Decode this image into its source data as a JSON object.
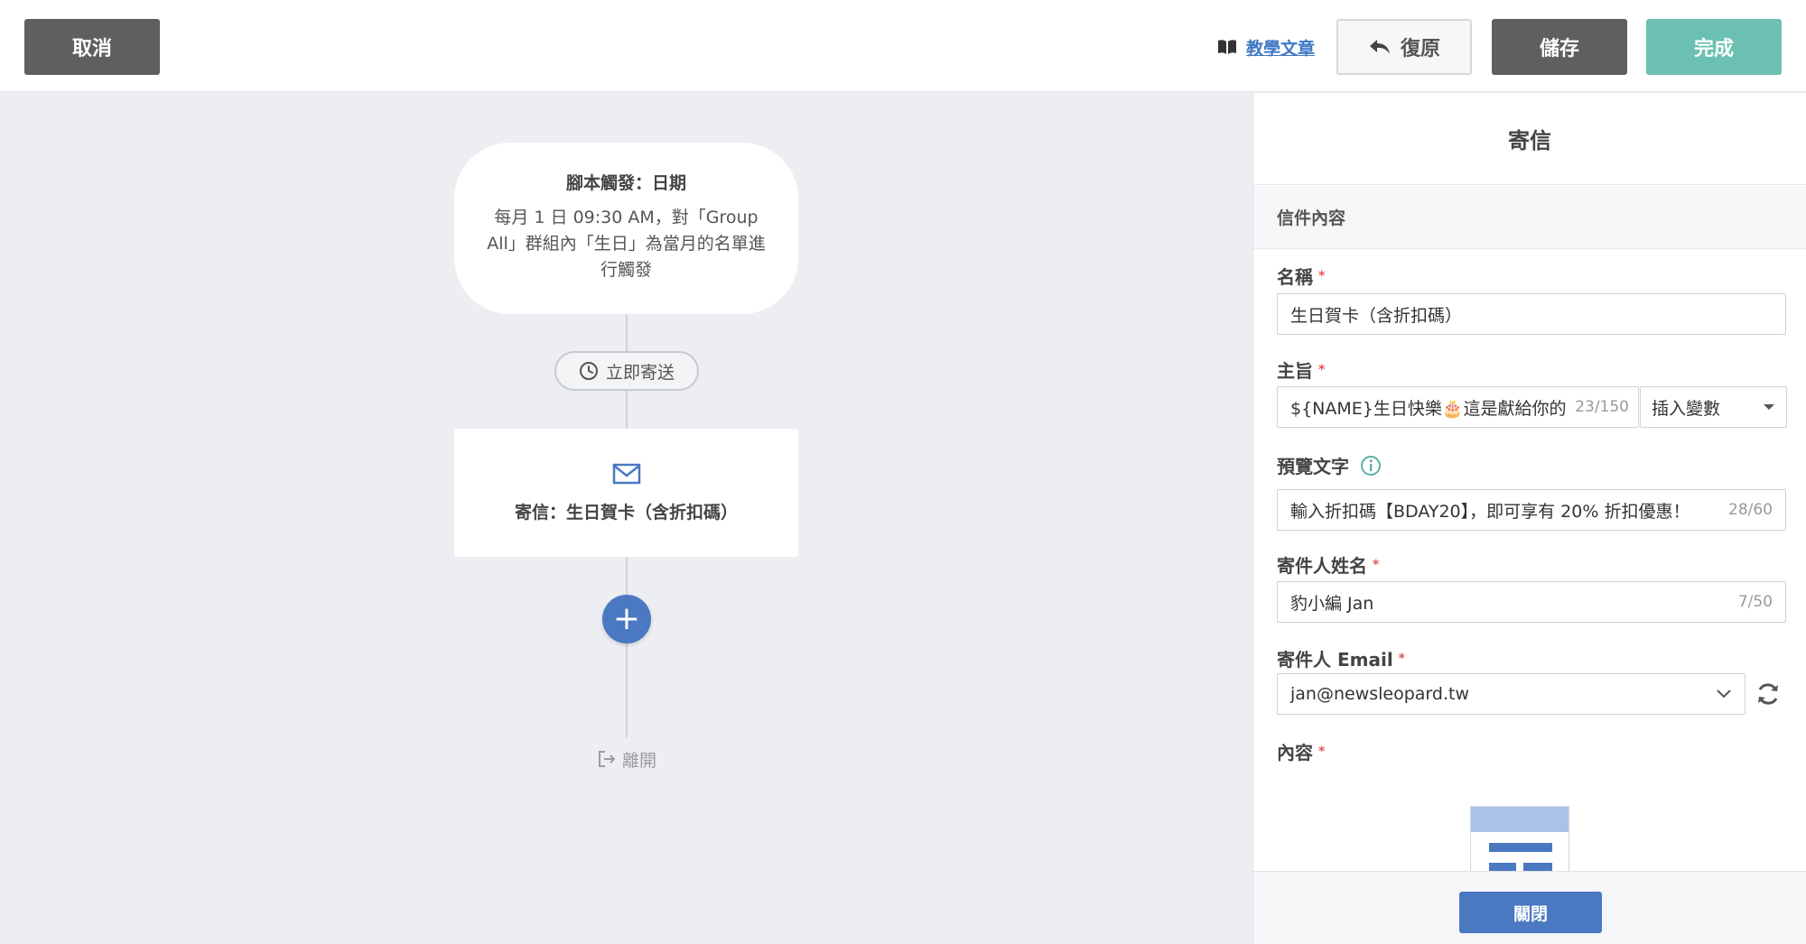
{
  "toolbar": {
    "cancel_label": "取消",
    "tutorial_label": "教學文章",
    "undo_label": "復原",
    "save_label": "儲存",
    "done_label": "完成"
  },
  "flow": {
    "trigger_title": "腳本觸發：日期",
    "trigger_desc": "每月 1 日 09:30 AM，對「Group All」群組內「生日」為當月的名單進行觸發",
    "delay_label": "立即寄送",
    "email_node_label": "寄信：生日賀卡（含折扣碼）",
    "add_label": "+",
    "exit_label": "離開"
  },
  "panel": {
    "title": "寄信",
    "section_title": "信件內容",
    "name_label": "名稱",
    "name_value": "生日賀卡（含折扣碼）",
    "subject_label": "主旨",
    "subject_value": "${NAME}生日快樂🎂這是獻給你的",
    "subject_count": "23/150",
    "insert_var_label": "插入變數",
    "preview_label": "預覽文字",
    "preview_value": "輸入折扣碼【BDAY20】，即可享有 20% 折扣優惠！",
    "preview_count": "28/60",
    "sender_name_label": "寄件人姓名",
    "sender_name_value": "豹小編 Jan",
    "sender_name_count": "7/50",
    "sender_email_label": "寄件人 Email",
    "sender_email_value": "jan@newsleopard.tw",
    "content_label": "內容",
    "required_mark": "*",
    "close_label": "關閉"
  },
  "colors": {
    "accent_blue": "#4a78c1",
    "done_teal": "#6cc0b1",
    "dark_button": "#5f5f5f",
    "required_red": "#e25656"
  }
}
